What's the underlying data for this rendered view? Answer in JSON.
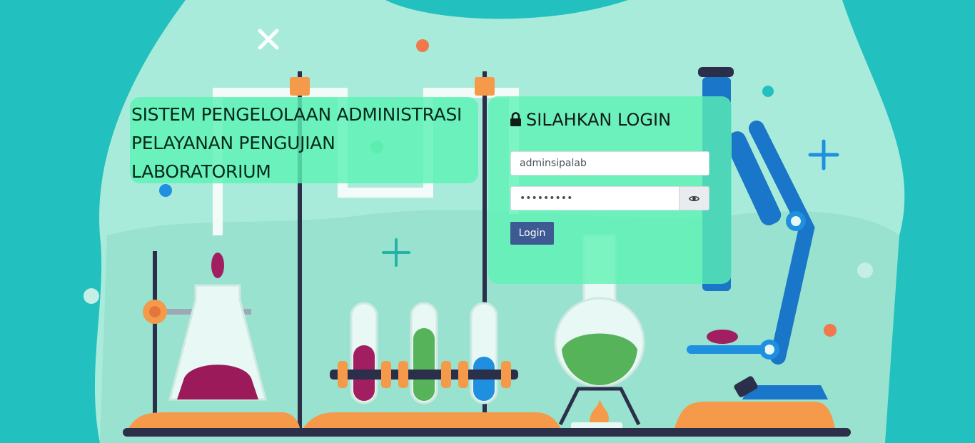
{
  "header": {
    "title_lines": [
      "SISTEM PENGELOLAAN ADMINISTRASI",
      "PELAYANAN PENGUJIAN",
      "LABORATORIUM"
    ]
  },
  "login": {
    "heading": "SILAHKAN LOGIN",
    "username_value": "adminsipalab",
    "password_value": "adminsipa",
    "submit_label": "Login",
    "lock_icon": "lock-icon",
    "eye_icon": "eye-icon"
  },
  "colors": {
    "background": "#22c0be",
    "panel": "#5cf2b4",
    "button": "#3d5a92"
  }
}
